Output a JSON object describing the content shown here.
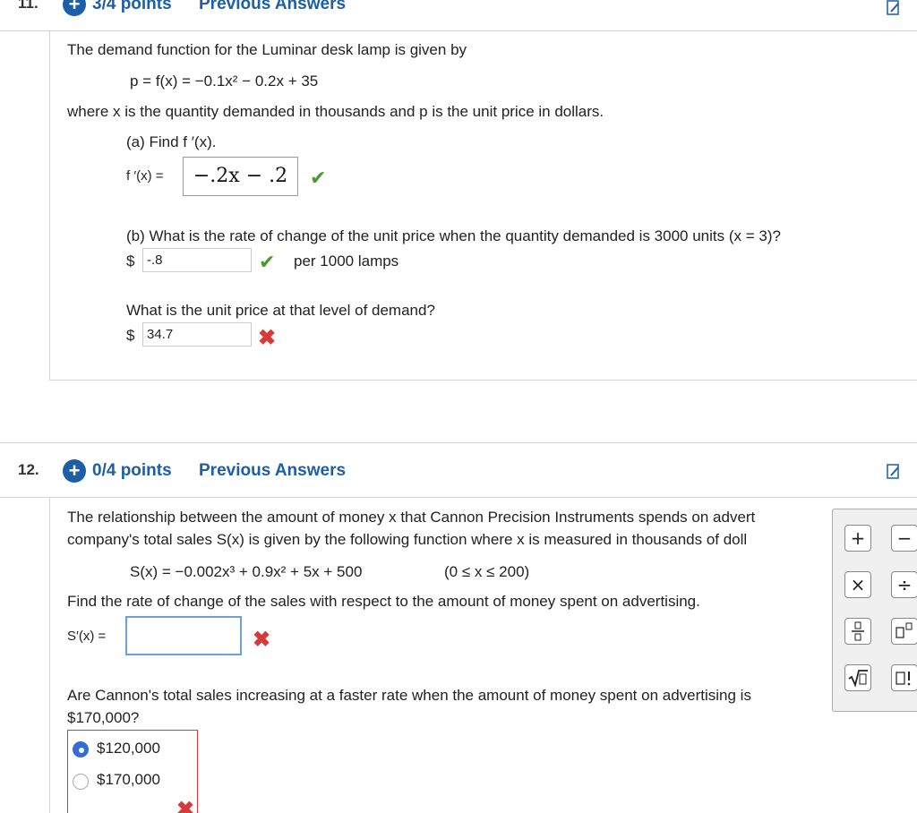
{
  "q11": {
    "number": "11.",
    "points": "3/4 points",
    "previous": "Previous Answers",
    "intro": "The demand function for the Luminar desk lamp is given by",
    "equation": "p = f(x) = −0.1x² − 0.2x + 35",
    "where": "where x is the quantity demanded in thousands and p is the unit price in dollars.",
    "part_a": "(a) Find f ′(x).",
    "fprime_label": "f ′(x) =",
    "fprime_answer": "−.2x − .2",
    "part_b": "(b) What is the rate of change of the unit price when the quantity demanded is 3000 units (x = 3)?",
    "dollar": "$",
    "rate_answer": "-.8",
    "rate_unit": "per 1000 lamps",
    "price_question": "What is the unit price at that level of demand?",
    "price_answer": "34.7"
  },
  "q12": {
    "number": "12.",
    "points": "0/4 points",
    "previous": "Previous Answers",
    "intro_line1": "The relationship between the amount of money x that Cannon Precision Instruments spends on advert",
    "intro_line2": "company's total sales S(x) is given by the following function where x is measured in thousands of doll",
    "equation": "S(x) = −0.002x³ + 0.9x² + 5x + 500",
    "domain": "(0 ≤ x ≤ 200)",
    "find_rate": "Find the rate of change of the sales with respect to the amount of money spent on advertising.",
    "sprime_label": "S′(x) =",
    "sprime_answer": "",
    "question2_line1": "Are Cannon's total sales increasing at a faster rate when the amount of money spent on advertising is",
    "question2_line2": "$170,000?",
    "options": [
      {
        "label": "$120,000",
        "selected": true
      },
      {
        "label": "$170,000",
        "selected": false
      }
    ]
  },
  "palette": {
    "buttons": [
      "+",
      "−",
      "×",
      "÷",
      "frac",
      "power",
      "sqrt",
      "factorial"
    ]
  },
  "icons": {
    "plus": "+",
    "check": "✔",
    "cross": "✖"
  },
  "colors": {
    "accent": "#1c5fa8",
    "correct": "#4a9a2b",
    "incorrect": "#d83a3a",
    "radio_selected": "#2f6fd4"
  }
}
